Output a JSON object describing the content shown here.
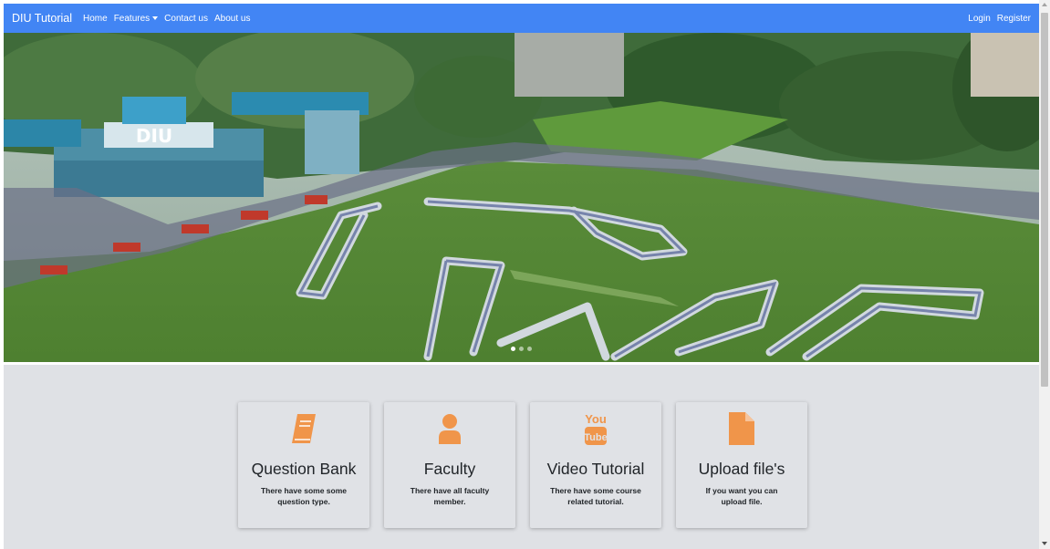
{
  "navbar": {
    "brand": "DIU Tutorial",
    "links": [
      {
        "label": "Home"
      },
      {
        "label": "Features"
      },
      {
        "label": "Contact us"
      },
      {
        "label": "About us"
      }
    ],
    "right_links": [
      {
        "label": "Login"
      },
      {
        "label": "Register"
      }
    ],
    "color": "#4285f4"
  },
  "hero": {
    "sign_text": "DIU",
    "slides_count": 3,
    "active_slide": 1
  },
  "features": {
    "icon_color": "#f0954a",
    "cards": [
      {
        "icon": "book-icon",
        "title": "Question Bank",
        "desc": "There have some some question type."
      },
      {
        "icon": "user-icon",
        "title": "Faculty",
        "desc": "There have all faculty member."
      },
      {
        "icon": "youtube-icon",
        "icon_text_top": "You",
        "icon_text_bottom": "Tube",
        "title": "Video Tutorial",
        "desc": "There have some course related tutorial."
      },
      {
        "icon": "file-icon",
        "title": "Upload file's",
        "desc": "If you want you can upload file."
      }
    ]
  }
}
